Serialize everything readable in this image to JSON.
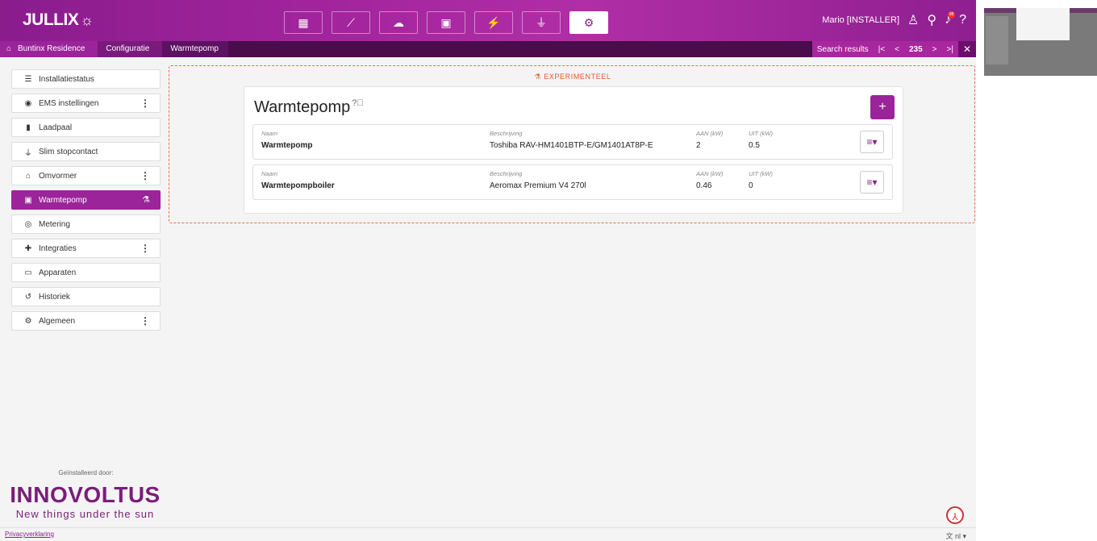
{
  "header": {
    "logo": "JULLIX",
    "nav_icons": [
      "dashboard-icon",
      "chart-line-icon",
      "brain-icon",
      "money-icon",
      "charger-icon",
      "plug-icon",
      "gear-icon"
    ],
    "user": "Mario [INSTALLER]",
    "notification_count": "98"
  },
  "breadcrumb": {
    "items": [
      "Buntinx Residence",
      "Configuratie",
      "Warmtepomp"
    ]
  },
  "search_nav": {
    "label": "Search results",
    "first": "|<",
    "prev": "<",
    "count": "235",
    "next": ">",
    "last": ">|",
    "close": "✕"
  },
  "sidebar": {
    "items": [
      {
        "label": "Installatiestatus",
        "icon": "status-icon"
      },
      {
        "label": "EMS instellingen",
        "icon": "ems-icon"
      },
      {
        "label": "Laadpaal",
        "icon": "charger-icon"
      },
      {
        "label": "Slim stopcontact",
        "icon": "plug-icon"
      },
      {
        "label": "Omvormer",
        "icon": "home-icon"
      },
      {
        "label": "Warmtepomp",
        "icon": "heatpump-icon"
      },
      {
        "label": "Metering",
        "icon": "meter-icon"
      },
      {
        "label": "Integraties",
        "icon": "puzzle-icon"
      },
      {
        "label": "Apparaten",
        "icon": "devices-icon"
      },
      {
        "label": "Historiek",
        "icon": "history-icon"
      },
      {
        "label": "Algemeen",
        "icon": "gear-icon"
      }
    ],
    "installed_by": "Geïnstalleerd door:",
    "brand": "INNOVOLTUS",
    "tagline": "New things under the sun"
  },
  "main": {
    "experimental_label": "EXPERIMENTEEL",
    "title": "Warmtepomp",
    "add_label": "+",
    "columns": {
      "name": "Naam",
      "description": "Beschrijving",
      "on": "AAN (kW)",
      "off": "UIT (kW)"
    },
    "rows": [
      {
        "name": "Warmtepomp",
        "description": "Toshiba RAV-HM1401BTP-E/GM1401AT8P-E",
        "on": "2",
        "off": "0.5"
      },
      {
        "name": "Warmtepompboiler",
        "description": "Aeromax Premium V4 270l",
        "on": "0.46",
        "off": "0"
      }
    ]
  },
  "footer": {
    "privacy": "Privacyverklaring",
    "language": "nl ▾"
  },
  "colors": {
    "brand_purple": "#9b249a",
    "dark_purple": "#4a0c4a",
    "experimental_orange": "#e05a2a"
  }
}
